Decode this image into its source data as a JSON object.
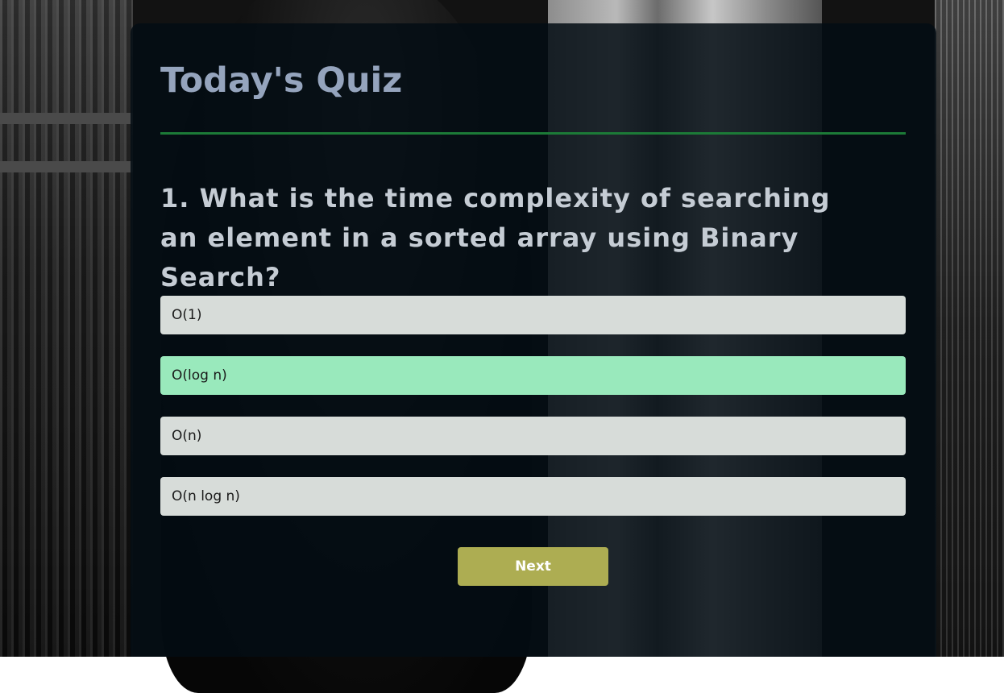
{
  "quiz": {
    "title": "Today's Quiz",
    "question": "1. What is the time complexity of searching an element in a sorted array using Binary Search?",
    "answers": [
      {
        "label": "O(1)",
        "selected": false
      },
      {
        "label": "O(log n)",
        "selected": true
      },
      {
        "label": "O(n)",
        "selected": false
      },
      {
        "label": "O(n log n)",
        "selected": false
      }
    ],
    "next_label": "Next"
  },
  "colors": {
    "title": "#95a4bd",
    "divider": "#1c7a37",
    "answer_default": "#d7dcd9",
    "answer_selected": "#99e9bc",
    "next_button": "#adad52"
  }
}
